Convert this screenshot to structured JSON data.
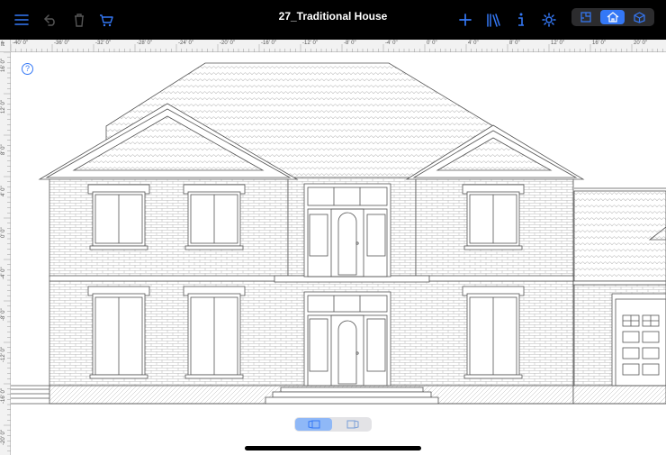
{
  "toolbar": {
    "title": "27_Traditional House",
    "left_icons": [
      "menu-icon",
      "undo-icon",
      "trash-icon",
      "cart-icon"
    ],
    "right_icons": [
      "plus-icon",
      "library-icon",
      "info-icon",
      "settings-icon"
    ],
    "view_modes": [
      "floor-plan-icon",
      "elevation-icon",
      "3d-icon"
    ],
    "active_view_mode": "elevation-icon"
  },
  "ruler": {
    "unit": "ft",
    "top_labels": [
      "-40' 0\"",
      "-36' 0\"",
      "-32' 0\"",
      "-28' 0\"",
      "-24' 0\"",
      "-20' 0\"",
      "-16' 0\"",
      "-12' 0\"",
      "-8' 0\"",
      "-4' 0\"",
      "0' 0\"",
      "4' 0\"",
      "8' 0\"",
      "12' 0\"",
      "16' 0\"",
      "20' 0\""
    ],
    "left_labels": [
      "16' 0\"",
      "12' 0\"",
      "8' 0\"",
      "4' 0\"",
      "0' 0\"",
      "-4' 0\"",
      "-8' 0\"",
      "-12' 0\"",
      "-16' 0\"",
      "-20' 0\""
    ]
  },
  "help": {
    "label": "?"
  },
  "bottom_toggle": {
    "options": [
      "front-elevation-icon",
      "side-elevation-icon"
    ],
    "active": "front-elevation-icon"
  },
  "colors": {
    "accent": "#3478f6",
    "toolbar_bg": "#000000",
    "line": "#555555"
  }
}
